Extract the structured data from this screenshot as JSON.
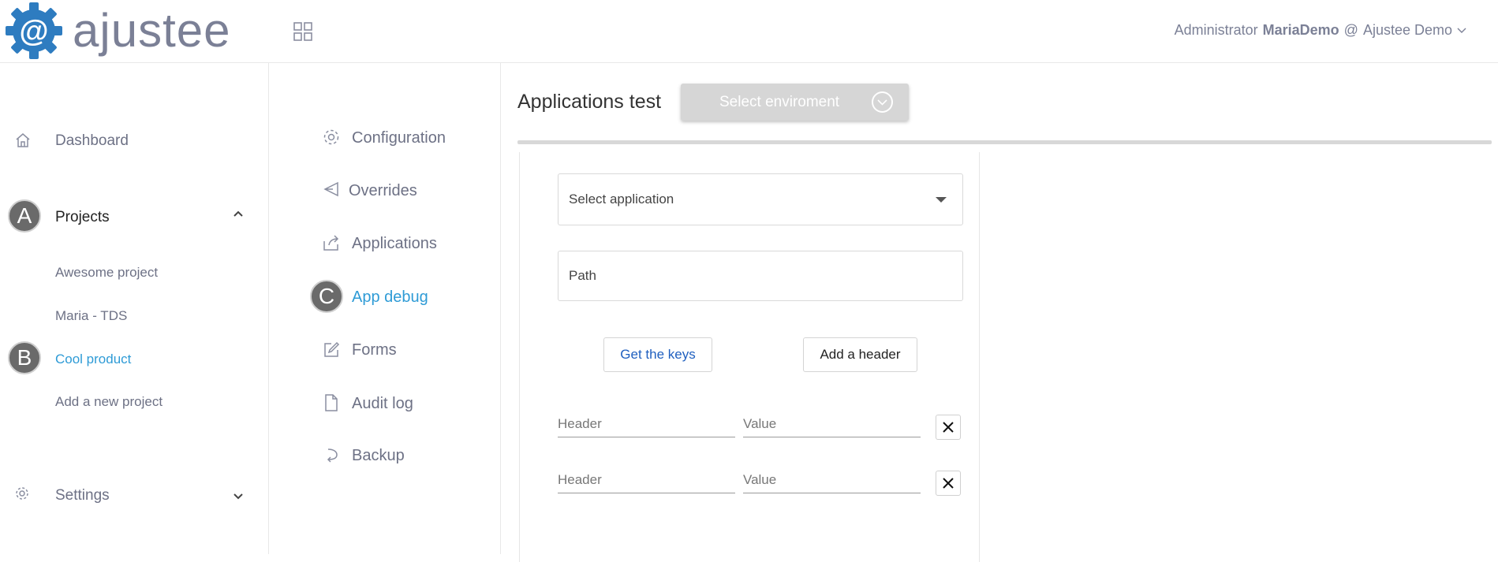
{
  "app": {
    "logo_glyph": "@",
    "logo_text": "ajustee",
    "brand_color": "#2e7cc0"
  },
  "header": {
    "apps_icon": "grid-icon",
    "user_role": "Administrator",
    "user_name": "MariaDemo",
    "at": "@",
    "org_name": "Ajustee Demo"
  },
  "sidebar": {
    "dashboard": {
      "label": "Dashboard",
      "icon": "home-icon"
    },
    "projects": {
      "label": "Projects",
      "badge": "A",
      "expanded": true,
      "items": [
        {
          "label": "Awesome project"
        },
        {
          "label": "Maria - TDS"
        },
        {
          "label": "Cool product",
          "badge": "B",
          "active": true
        },
        {
          "label": "Add a new project"
        }
      ]
    },
    "settings": {
      "label": "Settings",
      "icon": "gear-icon"
    }
  },
  "project_nav": {
    "items": [
      {
        "label": "Configuration",
        "icon": "gear-icon"
      },
      {
        "label": "Overrides",
        "icon": "send-icon"
      },
      {
        "label": "Applications",
        "icon": "share-icon"
      },
      {
        "label": "App debug",
        "badge": "C",
        "active": true
      },
      {
        "label": "Forms",
        "icon": "edit-icon"
      },
      {
        "label": "Audit log",
        "icon": "file-icon"
      },
      {
        "label": "Backup",
        "icon": "undo-icon"
      }
    ]
  },
  "main": {
    "title": "Applications test",
    "env_select": "Select enviroment",
    "app_select": "Select application",
    "path_placeholder": "Path",
    "get_keys": "Get the keys",
    "add_header": "Add a header",
    "headers": [
      {
        "name_placeholder": "Header",
        "value_placeholder": "Value"
      },
      {
        "name_placeholder": "Header",
        "value_placeholder": "Value"
      }
    ],
    "accent_color": "#2e9bd6"
  }
}
